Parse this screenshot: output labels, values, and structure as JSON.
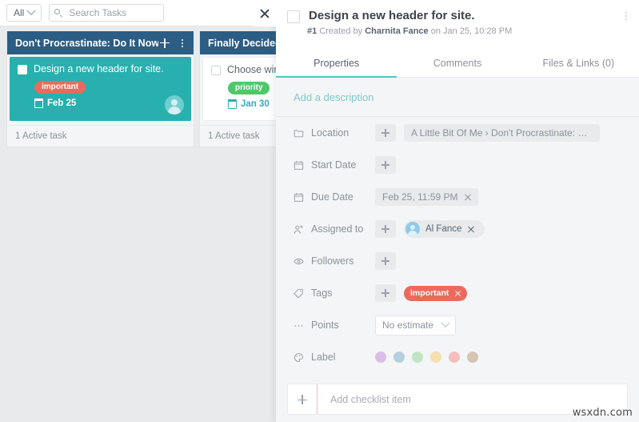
{
  "board": {
    "toolbar": {
      "filter_label": "All",
      "filter_icon": "chevron-down-icon",
      "search_icon": "search-icon",
      "search_placeholder": "Search Tasks",
      "search_value": ""
    },
    "columns": [
      {
        "title": "Don't Procrastinate: Do It Now!",
        "add_icon": "plus-icon",
        "menu_icon": "kebab-menu-icon",
        "footer": "1 Active task",
        "card": {
          "title": "Design a new header for site.",
          "tag": "important",
          "tag_color": "#ea6a5d",
          "date": "Feb 25",
          "date_icon": "calendar-icon",
          "selected": true,
          "avatar": "assignee-avatar"
        }
      },
      {
        "title": "Finally Decided t",
        "add_icon": "plus-icon",
        "menu_icon": "kebab-menu-icon",
        "footer": "1 Active task",
        "card": {
          "title": "Choose winne",
          "tag": "priority",
          "tag_color": "#4fc86a",
          "date": "Jan 30",
          "date_icon": "calendar-icon",
          "selected": false
        }
      }
    ]
  },
  "detail": {
    "close_icon": "close-icon",
    "menu_icon": "kebab-menu-icon",
    "title": "Design a new header for site.",
    "meta": {
      "id": "#1",
      "created_by_prefix": "Created by",
      "author": "Charnita Fance",
      "created_on": "on Jan 25, 10:28 PM"
    },
    "tabs": [
      {
        "label": "Properties",
        "active": true
      },
      {
        "label": "Comments",
        "active": false
      },
      {
        "label": "Files & Links (0)",
        "active": false
      }
    ],
    "description_link": "Add a description",
    "properties": [
      {
        "label": "Location",
        "icon": "folder-icon",
        "has_add": true,
        "add_icon": "plus-icon",
        "chip": {
          "kind": "plain",
          "text": "A Little Bit Of Me › Don't Procrastinate: D...",
          "removable": false
        }
      },
      {
        "label": "Start Date",
        "icon": "calendar-icon",
        "has_add": true,
        "add_icon": "plus-icon",
        "chip": null
      },
      {
        "label": "Due Date",
        "icon": "calendar-icon",
        "has_add": false,
        "chip": {
          "kind": "plain",
          "text": "Feb 25, 11:59 PM",
          "removable": true,
          "remove_icon": "close-icon"
        }
      },
      {
        "label": "Assigned to",
        "icon": "person-add-icon",
        "has_add": true,
        "add_icon": "plus-icon",
        "chip": {
          "kind": "avatar",
          "text": "Al Fance",
          "removable": true,
          "remove_icon": "close-icon",
          "avatar_icon": "user-avatar"
        }
      },
      {
        "label": "Followers",
        "icon": "eye-icon",
        "has_add": true,
        "add_icon": "plus-icon",
        "chip": null
      },
      {
        "label": "Tags",
        "icon": "tag-icon",
        "has_add": true,
        "add_icon": "plus-icon",
        "chip": {
          "kind": "tag",
          "text": "important",
          "removable": true,
          "remove_icon": "close-icon"
        }
      },
      {
        "label": "Points",
        "icon": "ellipsis-icon",
        "has_add": false,
        "select": {
          "value": "No estimate",
          "chevron_icon": "chevron-down-icon"
        }
      },
      {
        "label": "Label",
        "icon": "label-icon",
        "has_add": false,
        "swatches": [
          "#d9bfe8",
          "#b6cfe0",
          "#bfe5c4",
          "#f6dfae",
          "#f2bfbd",
          "#d6c5b4"
        ]
      }
    ],
    "checklist": {
      "add_icon": "plus-icon",
      "placeholder": "Add checklist item",
      "value": ""
    }
  },
  "watermark": "wsxdn.com"
}
